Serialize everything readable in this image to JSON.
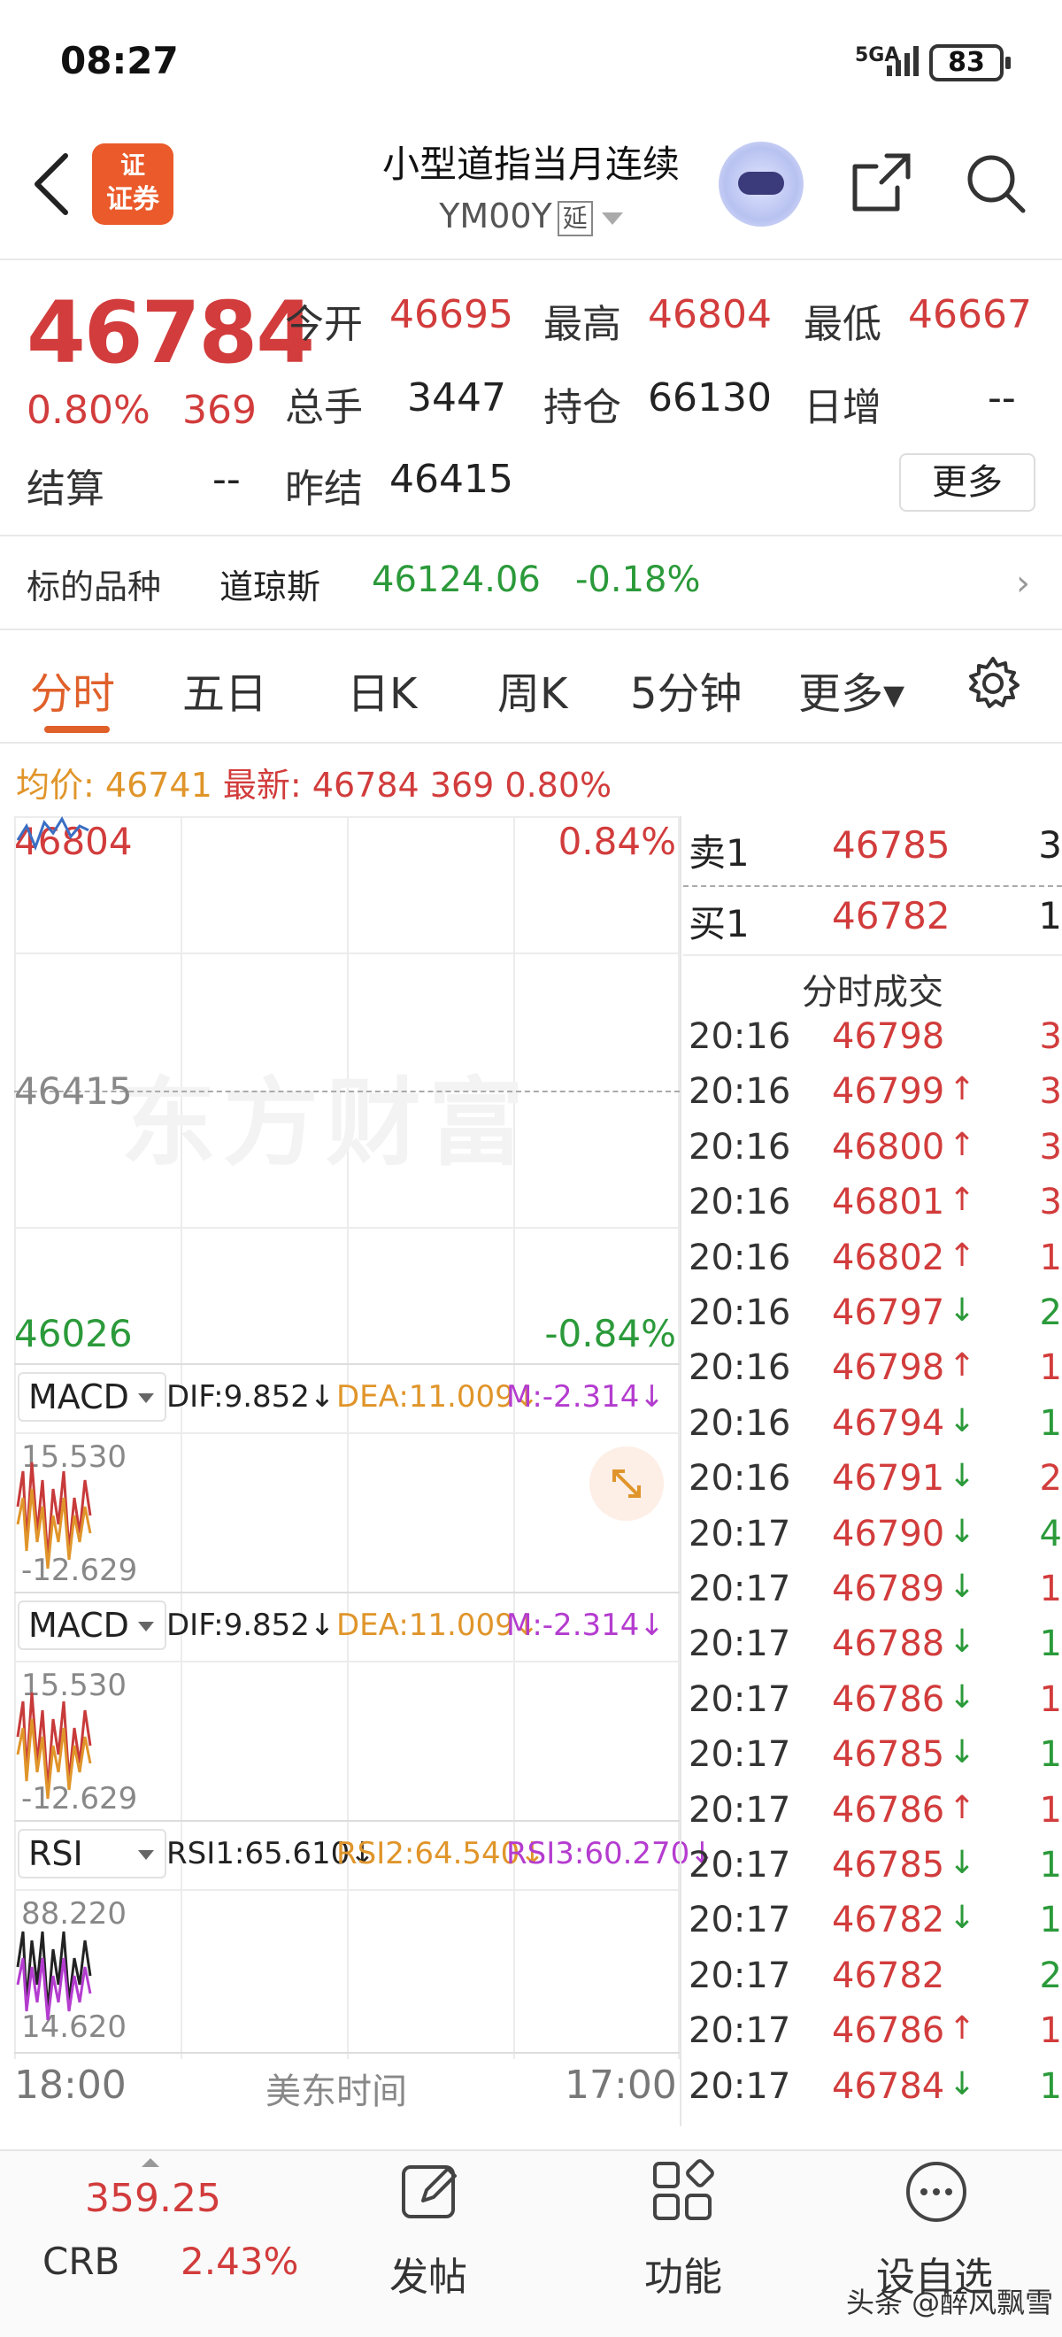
{
  "status": {
    "time": "08:27",
    "network": "5GA",
    "battery": "83"
  },
  "header": {
    "logo_top": "证",
    "logo_bottom": "证券",
    "title": "小型道指当月连续",
    "code": "YM00Y",
    "delay_tag": "延"
  },
  "quote": {
    "price": "46784",
    "change_pct": "0.80%",
    "change_val": "369",
    "open_label": "今开",
    "open": "46695",
    "high_label": "最高",
    "high": "46804",
    "low_label": "最低",
    "low": "46667",
    "volume_label": "总手",
    "volume": "3447",
    "oi_label": "持仓",
    "oi": "66130",
    "daily_inc_label": "日增",
    "daily_inc": "--",
    "settle_label": "结算",
    "settle": "--",
    "prev_settle_label": "昨结",
    "prev_settle": "46415",
    "more_button": "更多"
  },
  "underlying": {
    "label": "标的品种",
    "name": "道琼斯",
    "value": "46124.06",
    "pct": "-0.18%"
  },
  "tabs": [
    {
      "label": "分时"
    },
    {
      "label": "五日"
    },
    {
      "label": "日K"
    },
    {
      "label": "周K"
    },
    {
      "label": "5分钟"
    },
    {
      "label": "更多▾"
    }
  ],
  "summary": {
    "avg_label": "均价:",
    "avg": "46741",
    "latest_label": "最新:",
    "latest": "46784",
    "chg": "369",
    "pct": "0.80%"
  },
  "chart": {
    "top_price": "46804",
    "top_pct": "0.84%",
    "mid_price": "46415",
    "bottom_price": "46026",
    "bottom_pct": "-0.84%",
    "watermark": "东方财富",
    "time_left": "18:00",
    "time_mid": "美东时间",
    "time_right": "17:00"
  },
  "chart_data": {
    "type": "line",
    "title": "",
    "ylim": [
      46026,
      46804
    ],
    "reference": 46415,
    "series": [
      {
        "values": [
          46770,
          46790,
          46760,
          46795,
          46780,
          46800,
          46775,
          46790,
          46784
        ]
      }
    ],
    "xlabel": "美东时间"
  },
  "indicators": [
    {
      "name": "MACD",
      "dif": "DIF:9.852↓",
      "dea": "DEA:11.009↓",
      "m": "M:-2.314↓",
      "hi": "15.530",
      "lo": "-12.629"
    },
    {
      "name": "MACD",
      "dif": "DIF:9.852↓",
      "dea": "DEA:11.009↓",
      "m": "M:-2.314↓",
      "hi": "15.530",
      "lo": "-12.629"
    },
    {
      "name": "RSI",
      "dif": "RSI1:65.610↓",
      "dea": "RSI2:64.540↓",
      "m": "RSI3:60.270↓",
      "hi": "88.220",
      "lo": "14.620"
    }
  ],
  "orderbook": [
    {
      "label": "卖1",
      "price": "46785",
      "vol": "3"
    },
    {
      "label": "买1",
      "price": "46782",
      "vol": "1"
    }
  ],
  "ticks_title": "分时成交",
  "ticks": [
    {
      "t": "20:16",
      "p": "46798",
      "ar": "",
      "v": "3",
      "vc": "red"
    },
    {
      "t": "20:16",
      "p": "46799",
      "ar": "↑",
      "v": "3",
      "vc": "red"
    },
    {
      "t": "20:16",
      "p": "46800",
      "ar": "↑",
      "v": "3",
      "vc": "red"
    },
    {
      "t": "20:16",
      "p": "46801",
      "ar": "↑",
      "v": "3",
      "vc": "red"
    },
    {
      "t": "20:16",
      "p": "46802",
      "ar": "↑",
      "v": "1",
      "vc": "red"
    },
    {
      "t": "20:16",
      "p": "46797",
      "ar": "↓",
      "v": "2",
      "vc": "green"
    },
    {
      "t": "20:16",
      "p": "46798",
      "ar": "↑",
      "v": "1",
      "vc": "red"
    },
    {
      "t": "20:16",
      "p": "46794",
      "ar": "↓",
      "v": "1",
      "vc": "green"
    },
    {
      "t": "20:16",
      "p": "46791",
      "ar": "↓",
      "v": "2",
      "vc": "red"
    },
    {
      "t": "20:17",
      "p": "46790",
      "ar": "↓",
      "v": "4",
      "vc": "green"
    },
    {
      "t": "20:17",
      "p": "46789",
      "ar": "↓",
      "v": "1",
      "vc": "red"
    },
    {
      "t": "20:17",
      "p": "46788",
      "ar": "↓",
      "v": "1",
      "vc": "green"
    },
    {
      "t": "20:17",
      "p": "46786",
      "ar": "↓",
      "v": "1",
      "vc": "red"
    },
    {
      "t": "20:17",
      "p": "46785",
      "ar": "↓",
      "v": "1",
      "vc": "green"
    },
    {
      "t": "20:17",
      "p": "46786",
      "ar": "↑",
      "v": "1",
      "vc": "red"
    },
    {
      "t": "20:17",
      "p": "46785",
      "ar": "↓",
      "v": "1",
      "vc": "green"
    },
    {
      "t": "20:17",
      "p": "46782",
      "ar": "↓",
      "v": "1",
      "vc": "green"
    },
    {
      "t": "20:17",
      "p": "46782",
      "ar": "",
      "v": "2",
      "vc": "green"
    },
    {
      "t": "20:17",
      "p": "46786",
      "ar": "↑",
      "v": "1",
      "vc": "red"
    },
    {
      "t": "20:17",
      "p": "46784",
      "ar": "↓",
      "v": "1",
      "vc": "green"
    }
  ],
  "bottom": {
    "crb_value": "359.25",
    "crb_label": "CRB",
    "crb_pct": "2.43%",
    "post_label": "发帖",
    "func_label": "功能",
    "watch_label": "设自选",
    "footer_watermark": "头条 @醉风飘雪"
  },
  "colors": {
    "up": "#d23c3c",
    "down": "#2b9a3a",
    "accent": "#e0602a",
    "avg": "#e0952a"
  }
}
